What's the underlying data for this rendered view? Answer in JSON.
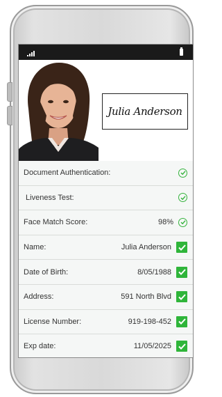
{
  "signature_text": "Julia Anderson",
  "icons": {
    "signal": "signal-bars-icon",
    "battery": "battery-icon",
    "verified": "circle-check-icon",
    "checked": "checkbox-checked-icon"
  },
  "colors": {
    "accent_green": "#2fb53a",
    "statusbar": "#1a1a1a"
  },
  "rows": [
    {
      "label": "Document Authentication:",
      "value": "",
      "icon": "circle-check"
    },
    {
      "label": " Liveness Test:",
      "value": "",
      "icon": "circle-check"
    },
    {
      "label": "Face Match Score:",
      "value": "98%",
      "icon": "circle-check"
    },
    {
      "label": "Name:",
      "value": "Julia Anderson",
      "icon": "square-check"
    },
    {
      "label": "Date of Birth:",
      "value": "8/05/1988",
      "icon": "square-check"
    },
    {
      "label": "Address:",
      "value": "591 North Blvd",
      "icon": "square-check"
    },
    {
      "label": "License Number:",
      "value": "919-198-452",
      "icon": "square-check"
    },
    {
      "label": "Exp date:",
      "value": "11/05/2025",
      "icon": "square-check"
    }
  ]
}
